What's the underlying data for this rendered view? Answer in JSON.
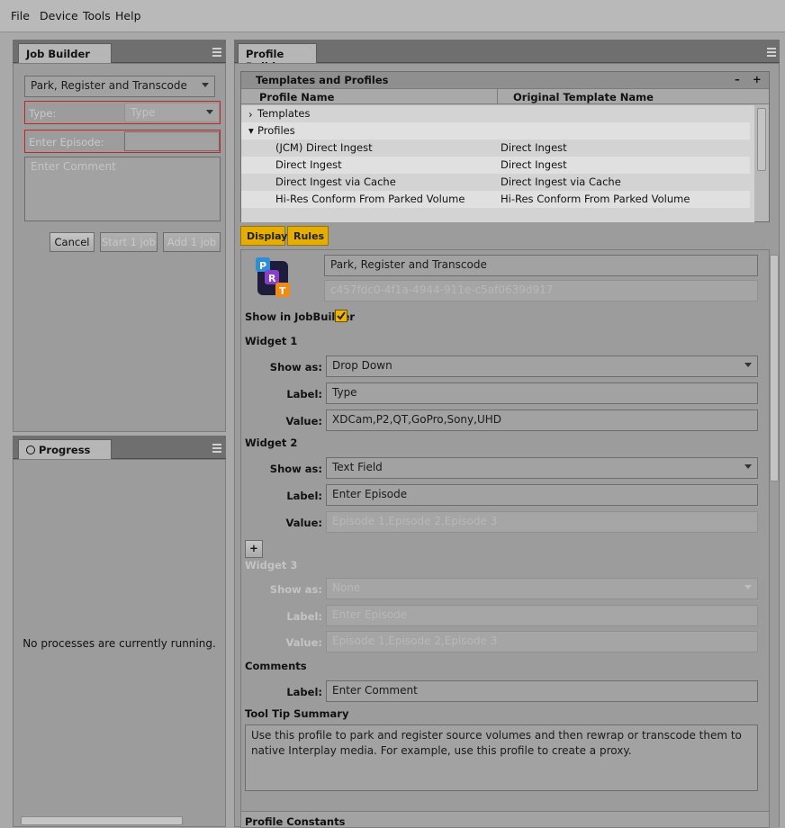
{
  "menu": [
    "File",
    "Device",
    "Tools",
    "Help"
  ],
  "job_builder": {
    "tab": "Job Builder",
    "profile_select": "Park, Register and Transcode",
    "type_label": "Type:",
    "type_value": "Type",
    "episode_label": "Enter Episode:",
    "episode_value": "",
    "comment_placeholder": "Enter Comment",
    "buttons": {
      "cancel": "Cancel",
      "start": "Start 1 job",
      "add": "Add 1 job"
    }
  },
  "progress": {
    "tab": "Progress",
    "clock_icon": "clock-icon",
    "message": "No processes are currently running."
  },
  "profile_builder": {
    "tab": "Profile Builder",
    "templates": {
      "title": "Templates and Profiles",
      "col_profile": "Profile Name",
      "col_template": "Original Template Name",
      "minus": "–",
      "plus": "+",
      "rows": [
        {
          "name": "Templates",
          "template": ""
        },
        {
          "name": "Profiles",
          "template": ""
        },
        {
          "name": "(JCM) Direct Ingest",
          "template": "Direct Ingest"
        },
        {
          "name": "Direct Ingest",
          "template": "Direct Ingest"
        },
        {
          "name": "Direct Ingest via Cache",
          "template": "Direct Ingest via Cache"
        },
        {
          "name": "Hi-Res Conform From Parked Volume",
          "template": "Hi-Res Conform From Parked Volume"
        }
      ]
    },
    "tabs": {
      "display": "Display",
      "rules": "Rules"
    },
    "display": {
      "profile_name": "Park, Register and Transcode",
      "profile_id": "c457fdc0-4f1a-4944-911e-c5af0639d917",
      "show_in_jobbuilder": "Show in JobBuilder",
      "show_in_jobbuilder_checked": true,
      "widget1": {
        "title": "Widget 1",
        "show_as_label": "Show as:",
        "show_as": "Drop Down",
        "label_label": "Label:",
        "label": "Type",
        "value_label": "Value:",
        "value": "XDCam,P2,QT,GoPro,Sony,UHD"
      },
      "widget2": {
        "title": "Widget 2",
        "show_as_label": "Show as:",
        "show_as": "Text Field",
        "label_label": "Label:",
        "label": "Enter Episode",
        "value_label": "Value:",
        "value": "Episode 1,Episode 2,Episode 3"
      },
      "add_widget": "+",
      "widget3": {
        "title": "Widget 3",
        "show_as_label": "Show as:",
        "show_as": "None",
        "label_label": "Label:",
        "label": "Enter Episode",
        "value_label": "Value:",
        "value": "Episode 1,Episode 2,Episode 3"
      },
      "comments": {
        "title": "Comments",
        "label_label": "Label:",
        "label": "Enter Comment"
      },
      "tooltip": {
        "title": "Tool Tip Summary",
        "text": "Use this profile to park and register source volumes and then rewrap or transcode them to native Interplay media. For example, use this profile to create a proxy."
      },
      "profile_constants": "Profile Constants"
    }
  }
}
